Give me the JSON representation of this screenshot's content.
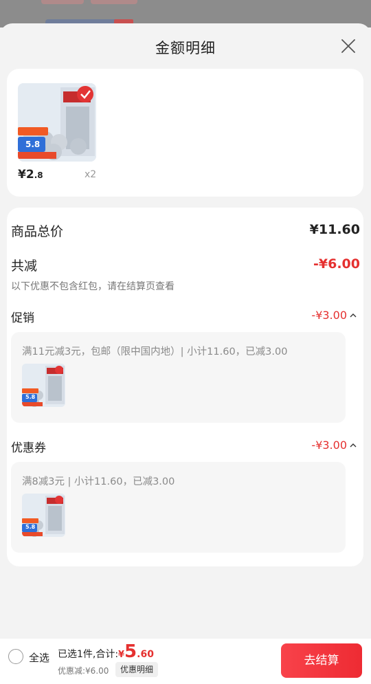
{
  "sheet": {
    "title": "金额明细",
    "close_icon": "close-icon"
  },
  "product": {
    "price_symbol": "¥",
    "price_int": "2",
    "price_dec": ".8",
    "quantity": "x2",
    "image_icon": "toilet-paper-product-image",
    "badge_text": "5.8"
  },
  "summary": {
    "total_label": "商品总价",
    "total_value": "¥11.60",
    "deduct_label": "共减",
    "deduct_value": "-¥6.00",
    "note": "以下优惠不包含红包，请在结算页查看"
  },
  "promotion": {
    "label": "促销",
    "value": "-¥3.00",
    "detail": "满11元减3元，包邮（限中国内地）| 小计11.60，已减3.00"
  },
  "coupon": {
    "label": "优惠券",
    "value": "-¥3.00",
    "detail": "满8减3元 | 小计11.60，已减3.00"
  },
  "footer": {
    "select_all": "全选",
    "selected": "已选1件,合计:",
    "total_symbol": "¥",
    "total_int": "5",
    "total_dec": ".60",
    "saved": "优惠减:¥6.00",
    "detail_button": "优惠明细",
    "checkout_button": "去结算"
  },
  "colors": {
    "accent_red": "#e5302f",
    "checkout_red": "#f8424a",
    "background": "#f3f3f3"
  }
}
